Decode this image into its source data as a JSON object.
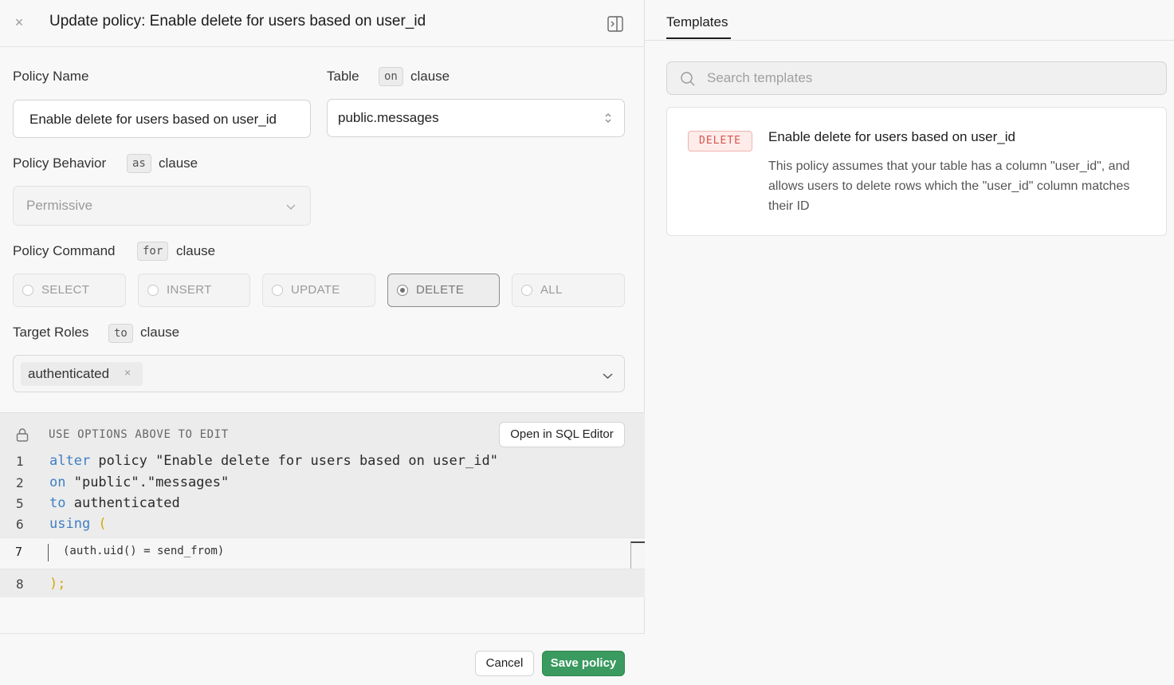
{
  "header": {
    "close_icon": "close-icon",
    "title": "Update policy: Enable delete for users based on user_id",
    "toggle_icon": "panel-right-icon"
  },
  "form": {
    "policy_name_label": "Policy Name",
    "policy_name_value": "Enable delete for users based on user_id",
    "table_label": "Table",
    "table_kw": "on",
    "table_clause": "clause",
    "table_value": "public.messages",
    "behavior_label": "Policy Behavior",
    "behavior_kw": "as",
    "behavior_clause": "clause",
    "behavior_value": "Permissive",
    "command_label": "Policy Command",
    "command_kw": "for",
    "command_clause": "clause",
    "commands": [
      {
        "label": "SELECT",
        "selected": false
      },
      {
        "label": "INSERT",
        "selected": false
      },
      {
        "label": "UPDATE",
        "selected": false
      },
      {
        "label": "DELETE",
        "selected": true
      },
      {
        "label": "ALL",
        "selected": false
      }
    ],
    "roles_label": "Target Roles",
    "roles_kw": "to",
    "roles_clause": "clause",
    "roles": [
      "authenticated"
    ]
  },
  "code": {
    "notice": "USE OPTIONS ABOVE TO EDIT",
    "open_sql_button": "Open in SQL Editor",
    "lines": [
      {
        "num": "1",
        "kw": "alter",
        "rest": " policy \"Enable delete for users based on user_id\""
      },
      {
        "num": "2",
        "kw": "on",
        "rest": " \"public\".\"messages\""
      },
      {
        "num": "5",
        "kw": "to",
        "rest": " authenticated"
      },
      {
        "num": "6",
        "kw": "using",
        "rest": " ("
      }
    ],
    "editor_line_num": "7",
    "editor_expr": "(auth.uid() = send_from)",
    "close_line_num": "8",
    "close_line": ");"
  },
  "footer": {
    "cancel_label": "Cancel",
    "save_label": "Save policy"
  },
  "templates": {
    "tab_label": "Templates",
    "search_placeholder": "Search templates",
    "items": [
      {
        "badge": "DELETE",
        "title": "Enable delete for users based on user_id",
        "description": "This policy assumes that your table has a column \"user_id\", and allows users to delete rows which the \"user_id\" column matches their ID"
      }
    ]
  },
  "colors": {
    "accent_green": "#3a9a5f",
    "keyword_blue": "#3f7fc4",
    "delete_badge": "#d9534f"
  }
}
